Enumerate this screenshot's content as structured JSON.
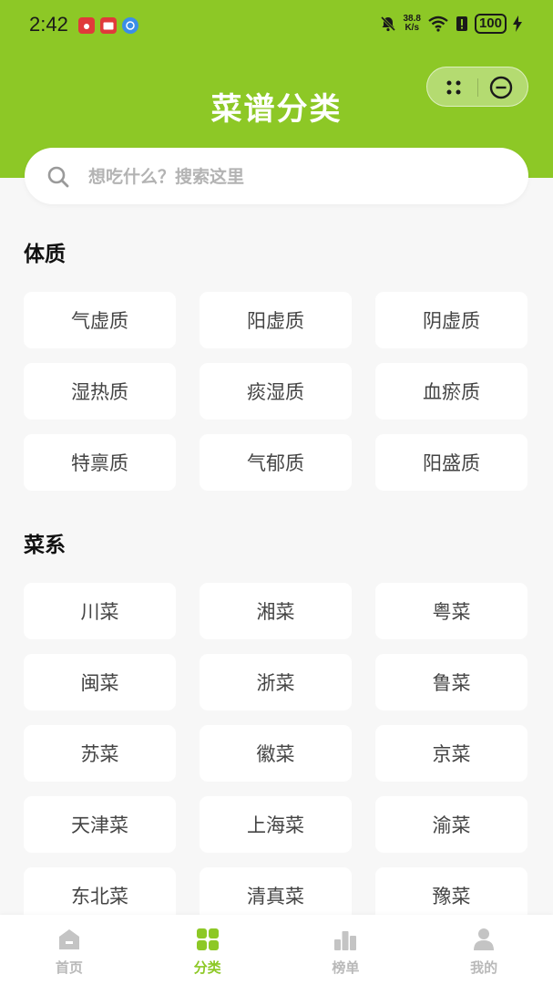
{
  "status_bar": {
    "time": "2:42",
    "net_speed_value": "38.8",
    "net_speed_unit": "K/s",
    "battery": "100"
  },
  "header": {
    "title": "菜谱分类"
  },
  "search": {
    "placeholder": "想吃什么？搜索这里"
  },
  "sections": [
    {
      "title": "体质",
      "items": [
        "气虚质",
        "阳虚质",
        "阴虚质",
        "湿热质",
        "痰湿质",
        "血瘀质",
        "特禀质",
        "气郁质",
        "阳盛质"
      ]
    },
    {
      "title": "菜系",
      "items": [
        "川菜",
        "湘菜",
        "粤菜",
        "闽菜",
        "浙菜",
        "鲁菜",
        "苏菜",
        "徽菜",
        "京菜",
        "天津菜",
        "上海菜",
        "渝菜",
        "东北菜",
        "清真菜",
        "豫菜"
      ]
    }
  ],
  "tabbar": {
    "items": [
      {
        "label": "首页",
        "icon": "home-icon",
        "active": false
      },
      {
        "label": "分类",
        "icon": "category-icon",
        "active": true
      },
      {
        "label": "榜单",
        "icon": "ranking-icon",
        "active": false
      },
      {
        "label": "我的",
        "icon": "profile-icon",
        "active": false
      }
    ]
  },
  "colors": {
    "accent": "#8dc826",
    "inactive_tab": "#b9b9b9",
    "background": "#f7f7f7"
  }
}
